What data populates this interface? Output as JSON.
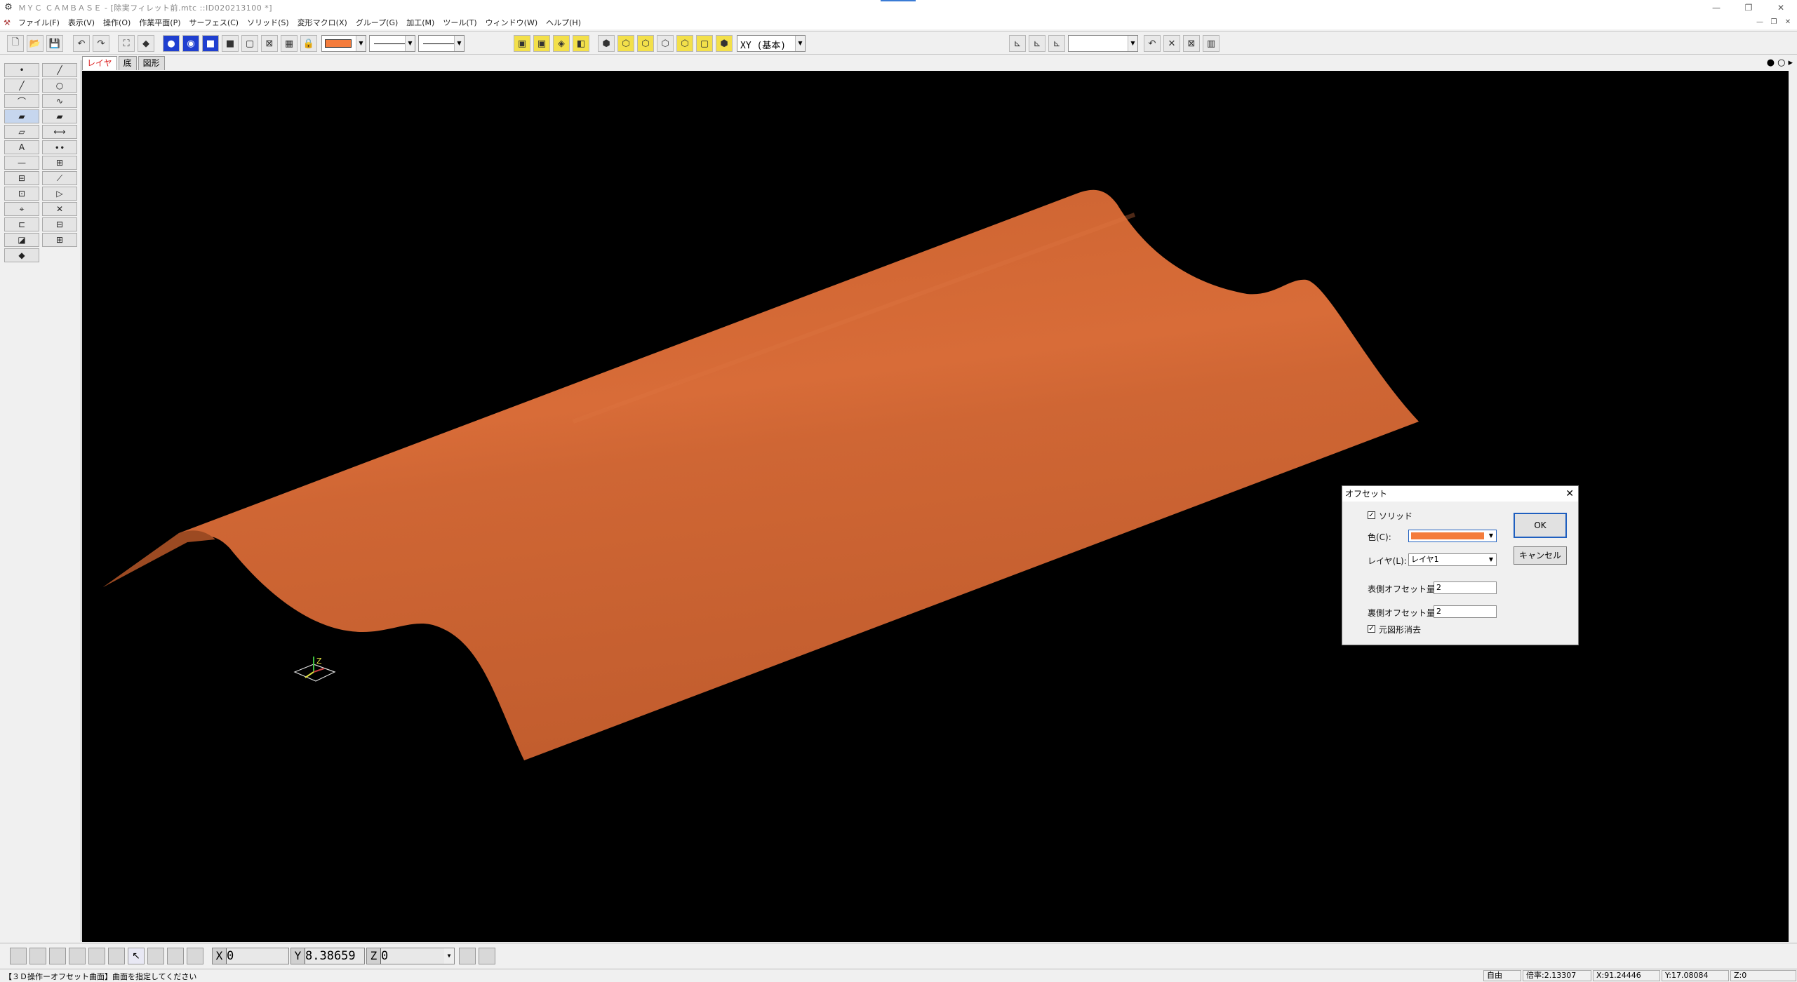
{
  "window": {
    "title": "ＭＹＣ ＣＡＭＢＡＳＥ - [除実フィレット前.mtc ::ID020213100 *]",
    "controls": [
      "—",
      "❐",
      "✕"
    ]
  },
  "menu": {
    "items": [
      "ファイル(F)",
      "表示(V)",
      "操作(O)",
      "作業平面(P)",
      "サーフェス(C)",
      "ソリッド(S)",
      "変形マクロ(X)",
      "グループ(G)",
      "加工(M)",
      "ツール(T)",
      "ウィンドウ(W)",
      "ヘルプ(H)"
    ],
    "mdi_controls": [
      "—",
      "❐",
      "✕"
    ]
  },
  "toolbar": {
    "plane": "XY (基本)",
    "current_color": "#f47c3c"
  },
  "tabs": [
    "レイヤ",
    "底",
    "図形"
  ],
  "view_controls": [
    "●",
    "○",
    "▸"
  ],
  "palette": {
    "left": [
      "•",
      "╱",
      "⌒",
      "▰",
      "▱",
      "A",
      "—",
      "⊟",
      "⊡",
      "⌖",
      "⊏",
      "◪",
      "◆"
    ],
    "right": [
      "╱",
      "○",
      "∿",
      "▰",
      "⟷",
      "∙∙",
      "⊞",
      "⟋",
      "▷",
      "✕",
      "⊟",
      "⊞"
    ]
  },
  "dialog": {
    "title": "オフセット",
    "close": "✕",
    "solid_label": "ソリッド",
    "solid_checked": "✓",
    "color_label": "色(C):",
    "color_value": "#f47c3c",
    "layer_label": "レイヤ(L):",
    "layer_value": "レイヤ1",
    "front_offset_label": "表側オフセット量",
    "front_offset_value": "2",
    "back_offset_label": "裏側オフセット量",
    "back_offset_value": "2",
    "delete_original_label": "元図形消去",
    "delete_original_checked": "✓",
    "ok_label": "OK",
    "cancel_label": "キャンセル"
  },
  "coords": {
    "x_axis": "X",
    "x_value": "0",
    "y_axis": "Y",
    "y_value": "8.38659",
    "z_axis": "Z",
    "z_value": "0"
  },
  "status": {
    "message": "【３Ｄ操作ーオフセット曲面】曲面を指定してください",
    "mode": "自由",
    "scale": "倍率:2.13307",
    "x": "X:91.24446",
    "y": "Y:17.08084",
    "z": "Z:0"
  },
  "colors": {
    "surface": "#d26a38",
    "surface_shade": "#b85a2c",
    "viewport_bg": "#000000"
  }
}
